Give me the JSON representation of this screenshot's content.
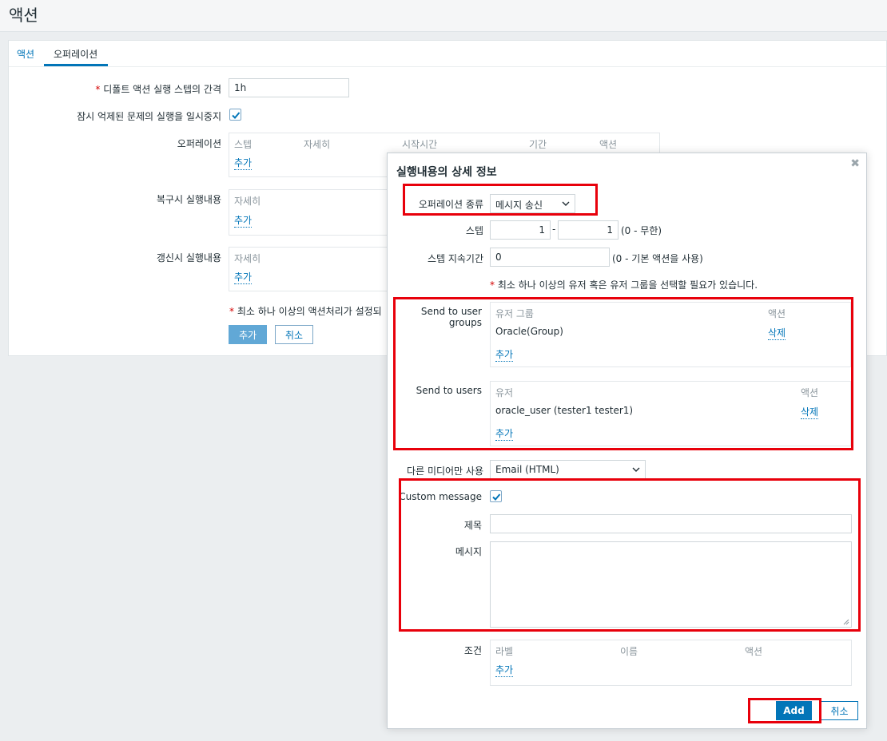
{
  "page": {
    "title": "액션"
  },
  "tabs": [
    {
      "label": "액션"
    },
    {
      "label": "오퍼레이션"
    }
  ],
  "form": {
    "default_step": {
      "label": "디폴트 액션 실행 스텝의 간격",
      "value": "1h",
      "required": "*"
    },
    "pause_label": "잠시 억제된 문제의 실행을 일시중지",
    "operations": {
      "label": "오퍼레이션",
      "columns": [
        "스텝",
        "자세히",
        "시작시간",
        "기간",
        "액션"
      ],
      "add": "추가"
    },
    "recovery": {
      "label": "복구시 실행내용",
      "column": "자세히",
      "add": "추가"
    },
    "update": {
      "label": "갱신시 실행내용",
      "column": "자세히",
      "add": "추가"
    },
    "note": "최소 하나 이상의 액션처리가 설정되",
    "add_button": "추가",
    "cancel_button": "취소"
  },
  "dialog": {
    "title": "실행내용의 상세 정보",
    "operation_type": {
      "label": "오퍼레이션 종류",
      "value": "메시지 송신"
    },
    "steps": {
      "label": "스텝",
      "from": "1",
      "sep": "-",
      "to": "1",
      "hint": "(0 - 무한)"
    },
    "step_duration": {
      "label": "스텝 지속기간",
      "value": "0",
      "hint": "(0 - 기본 액션을 사용)"
    },
    "note": "최소 하나 이상의 유저 혹은 유저 그룹을 선택할 필요가 있습니다.",
    "user_groups": {
      "label": "Send to user groups",
      "columns": [
        "유저 그룹",
        "액션"
      ],
      "rows": [
        {
          "name": "Oracle(Group)",
          "action": "삭제"
        }
      ],
      "add": "추가"
    },
    "users": {
      "label": "Send to users",
      "columns": [
        "유저",
        "액션"
      ],
      "rows": [
        {
          "name": "oracle_user (tester1 tester1)",
          "action": "삭제"
        }
      ],
      "add": "추가"
    },
    "media": {
      "label": "다른 미디어만 사용",
      "value": "Email (HTML)"
    },
    "custom_message": {
      "label": "Custom message",
      "checked": true
    },
    "subject": {
      "label": "제목",
      "value": ""
    },
    "message": {
      "label": "메시지",
      "value": ""
    },
    "conditions": {
      "label": "조건",
      "columns": [
        "라벨",
        "이름",
        "액션"
      ],
      "add": "추가"
    },
    "add_button": "Add",
    "cancel_button": "취소"
  },
  "colors": {
    "accent": "#0275b8",
    "highlight_frame": "#e8000b",
    "required": "#d40000"
  }
}
